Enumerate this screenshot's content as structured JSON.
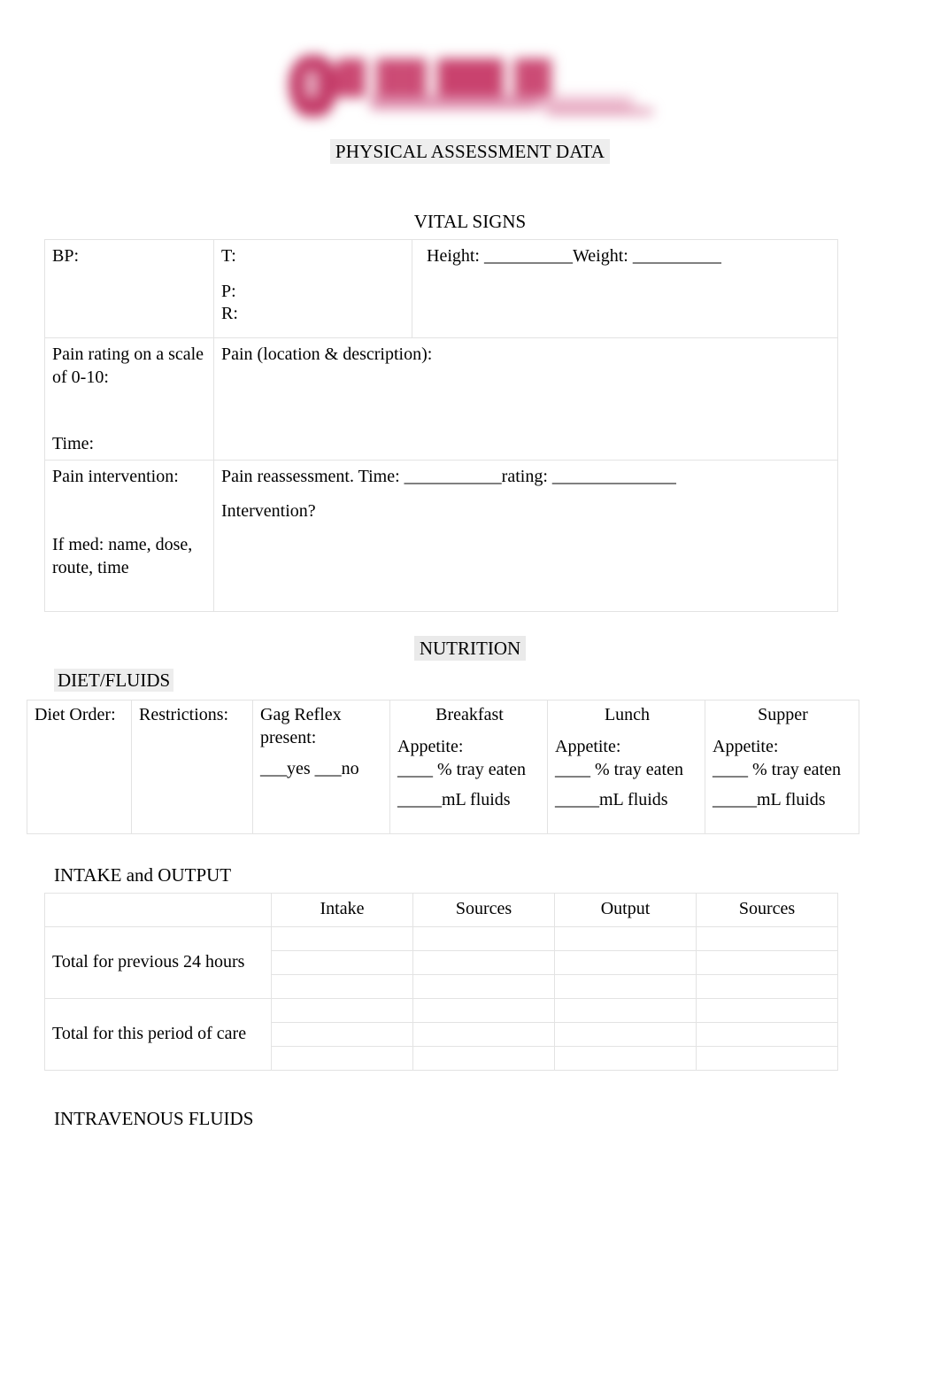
{
  "document": {
    "title": "PHYSICAL ASSESSMENT DATA",
    "logo_alt": "university-logo"
  },
  "vital_signs": {
    "heading": "VITAL SIGNS",
    "row1": {
      "bp_label": "BP:",
      "temp_label": "T:",
      "pulse_label": "P:",
      "resp_label": "R:",
      "height_weight_label": "Height: __________Weight: __________"
    },
    "row2": {
      "pain_rating_label": "Pain rating on a scale of 0-10:",
      "time_label": "Time:",
      "pain_location_label": "Pain (location & description):"
    },
    "row3": {
      "pain_intervention_label": "Pain intervention:",
      "if_med_label": "If med: name, dose, route, time",
      "pain_reassessment_label": "Pain reassessment.  Time: ___________rating: ______________",
      "intervention_label": "Intervention?"
    }
  },
  "nutrition": {
    "heading": "NUTRITION",
    "diet_fluids": {
      "heading": "DIET/FLUIDS",
      "diet_order_label": "Diet Order:",
      "restrictions_label": "Restrictions:",
      "gag_reflex_label": "Gag Reflex present:",
      "gag_reflex_options": "___yes ___no",
      "meals": [
        {
          "name": "Breakfast",
          "appetite_label": "Appetite:",
          "tray_label": "____ % tray eaten",
          "fluids_label": "_____mL fluids"
        },
        {
          "name": "Lunch",
          "appetite_label": "Appetite:",
          "tray_label": "____ % tray eaten",
          "fluids_label": "_____mL fluids"
        },
        {
          "name": "Supper",
          "appetite_label": "Appetite:",
          "tray_label": "____ % tray eaten",
          "fluids_label": "_____mL fluids"
        }
      ]
    },
    "intake_output": {
      "heading": "INTAKE and OUTPUT",
      "columns": [
        "",
        "Intake",
        "Sources",
        "Output",
        "Sources"
      ],
      "rows": [
        {
          "label": "Total for previous 24 hours",
          "subrows": 3
        },
        {
          "label": "Total for this period of care",
          "subrows": 3
        }
      ]
    },
    "intravenous_fluids": {
      "heading": "INTRAVENOUS FLUIDS"
    }
  },
  "colors": {
    "logo_crimson": "#c33b68",
    "text": "#000000",
    "table_border": "#e3e3e3",
    "highlight": "#ededed"
  }
}
